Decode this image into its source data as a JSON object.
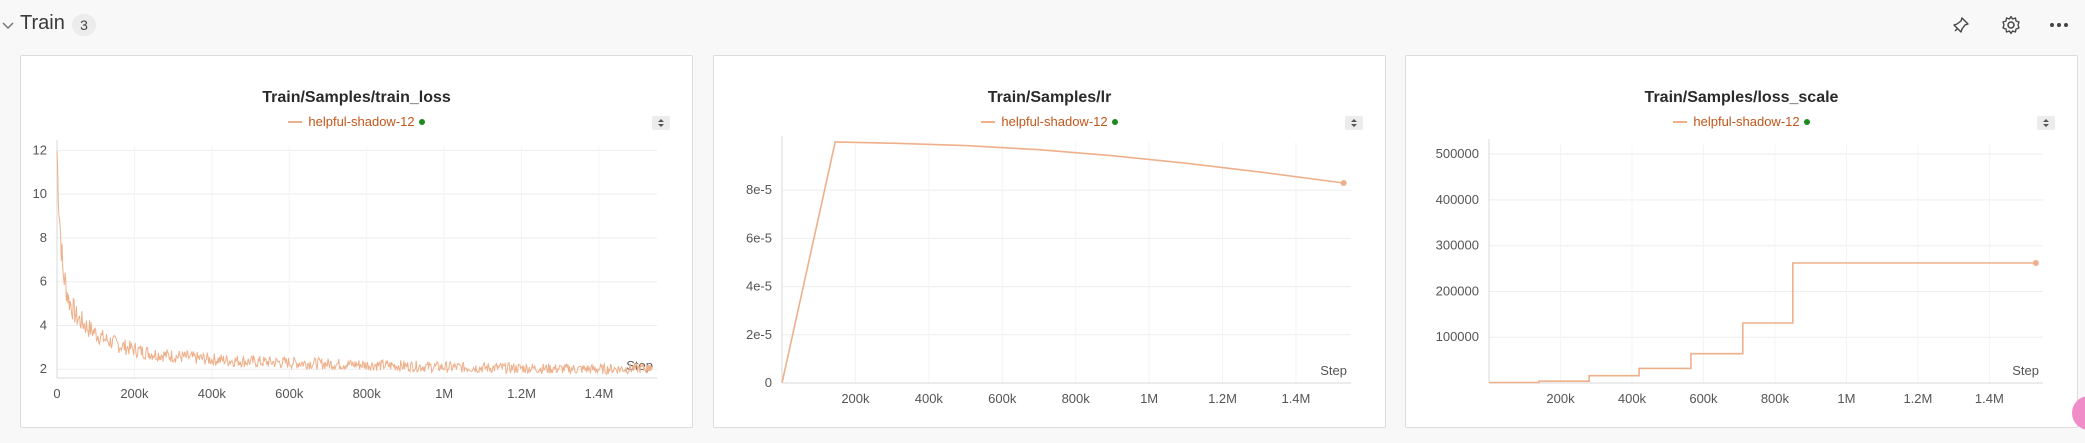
{
  "section": {
    "title": "Train",
    "count": "3"
  },
  "header_icons": [
    "pin-icon",
    "gear-icon",
    "more-icon"
  ],
  "series_color": "#eeb08b",
  "legend_text_color": "#c2561b",
  "status_dot_color": "#1d8a1d",
  "panels": [
    {
      "title": "Train/Samples/train_loss",
      "legend": "helpful-shadow-12",
      "step_label": "Step"
    },
    {
      "title": "Train/Samples/lr",
      "legend": "helpful-shadow-12",
      "step_label": "Step"
    },
    {
      "title": "Train/Samples/loss_scale",
      "legend": "helpful-shadow-12",
      "step_label": "Step"
    }
  ],
  "chart_data": [
    {
      "type": "line",
      "title": "Train/Samples/train_loss",
      "xlabel": "Step",
      "x_ticks": [
        "0",
        "200k",
        "400k",
        "600k",
        "800k",
        "1M",
        "1.2M",
        "1.4M"
      ],
      "y_ticks": [
        "2",
        "4",
        "6",
        "8",
        "10",
        "12"
      ],
      "xlim": [
        0,
        1550000
      ],
      "ylim": [
        1.6,
        12.2
      ],
      "grid": true,
      "series": [
        {
          "name": "helpful-shadow-12",
          "x": [
            0,
            5000,
            15000,
            30000,
            50000,
            80000,
            120000,
            160000,
            200000,
            250000,
            300000,
            400000,
            500000,
            600000,
            700000,
            800000,
            900000,
            1000000,
            1100000,
            1200000,
            1300000,
            1400000,
            1530000
          ],
          "y": [
            12,
            9.5,
            6.5,
            5.2,
            4.4,
            3.9,
            3.4,
            3.1,
            2.9,
            2.7,
            2.6,
            2.45,
            2.35,
            2.3,
            2.25,
            2.2,
            2.15,
            2.1,
            2.07,
            2.05,
            2.02,
            2.0,
            2.05
          ]
        }
      ]
    },
    {
      "type": "line",
      "title": "Train/Samples/lr",
      "xlabel": "Step",
      "x_ticks": [
        "200k",
        "400k",
        "600k",
        "800k",
        "1M",
        "1.2M",
        "1.4M"
      ],
      "y_ticks": [
        "0",
        "2e-5",
        "4e-5",
        "6e-5",
        "8e-5"
      ],
      "xlim": [
        0,
        1550000
      ],
      "ylim": [
        0,
        0.0001
      ],
      "grid": true,
      "series": [
        {
          "name": "helpful-shadow-12",
          "x": [
            0,
            145000,
            300000,
            500000,
            700000,
            900000,
            1100000,
            1300000,
            1530000
          ],
          "y": [
            0,
            0.0001,
            9.95e-05,
            9.85e-05,
            9.68e-05,
            9.43e-05,
            9.12e-05,
            8.76e-05,
            8.3e-05
          ]
        }
      ]
    },
    {
      "type": "line",
      "title": "Train/Samples/loss_scale",
      "xlabel": "Step",
      "x_ticks": [
        "200k",
        "400k",
        "600k",
        "800k",
        "1M",
        "1.2M",
        "1.4M"
      ],
      "y_ticks": [
        "100000",
        "200000",
        "300000",
        "400000",
        "500000"
      ],
      "xlim": [
        0,
        1550000
      ],
      "ylim": [
        0,
        520000
      ],
      "grid": true,
      "series": [
        {
          "name": "helpful-shadow-12",
          "x": [
            0,
            140000,
            140000,
            280000,
            280000,
            420000,
            420000,
            565000,
            565000,
            710000,
            710000,
            850000,
            850000,
            1530000
          ],
          "y": [
            1000,
            1000,
            4000,
            4000,
            16000,
            16000,
            32000,
            32000,
            64000,
            64000,
            131072,
            131072,
            262144,
            262144
          ]
        }
      ]
    }
  ]
}
